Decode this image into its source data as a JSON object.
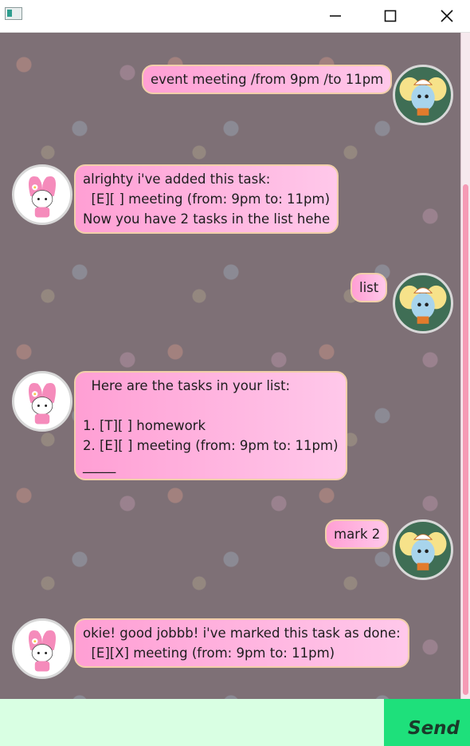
{
  "window": {
    "icons": {
      "app": "app-icon",
      "minimize": "minimize-icon",
      "maximize": "maximize-icon",
      "close": "close-icon"
    }
  },
  "messages": [
    {
      "sender": "user",
      "avatar": "elephant-avatar-icon",
      "text": "event meeting /from 9pm /to 11pm"
    },
    {
      "sender": "bot",
      "avatar": "my-melody-avatar-icon",
      "text": "alrighty i've added this task:\n  [E][ ] meeting (from: 9pm to: 11pm)\nNow you have 2 tasks in the list hehe"
    },
    {
      "sender": "user",
      "avatar": "elephant-avatar-icon",
      "text": "list"
    },
    {
      "sender": "bot",
      "avatar": "my-melody-avatar-icon",
      "text": "  Here are the tasks in your list:\n\n1. [T][ ] homework\n2. [E][ ] meeting (from: 9pm to: 11pm)\n_____"
    },
    {
      "sender": "user",
      "avatar": "elephant-avatar-icon",
      "text": "mark 2"
    },
    {
      "sender": "bot",
      "avatar": "my-melody-avatar-icon",
      "text": "okie! good jobbb! i've marked this task as done:\n  [E][X] meeting (from: 9pm to: 11pm)"
    }
  ],
  "input": {
    "value": "",
    "placeholder": ""
  },
  "send_button": {
    "label": "Send"
  },
  "colors": {
    "bubble_start": "#ff9fd4",
    "bubble_end": "#ffc8ea",
    "bubble_border": "#f1cfa9",
    "input_bg": "#d9ffe3",
    "send_bg": "#1ee07b",
    "scroll_thumb": "#f59ab5"
  }
}
